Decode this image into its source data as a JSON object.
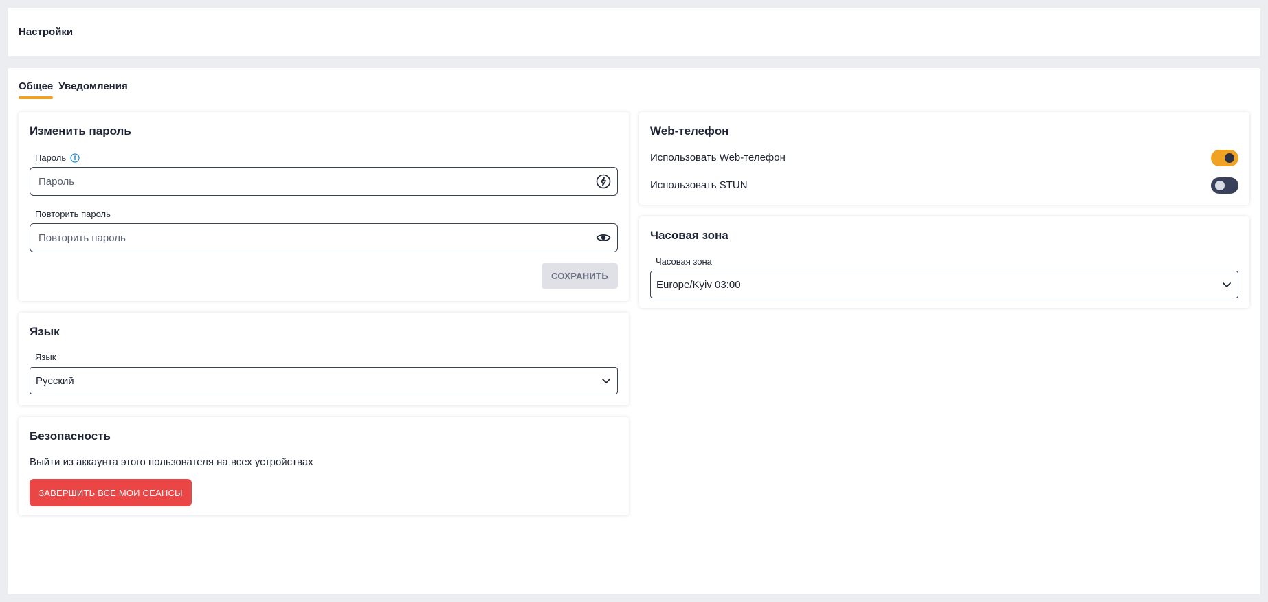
{
  "header": {
    "title": "Настройки"
  },
  "tabs": [
    {
      "label": "Общее",
      "active": true
    },
    {
      "label": "Уведомления",
      "active": false
    }
  ],
  "password_card": {
    "title": "Изменить пароль",
    "password": {
      "label": "Пароль",
      "placeholder": "Пароль",
      "value": ""
    },
    "repeat": {
      "label": "Повторить пароль",
      "placeholder": "Повторить пароль",
      "value": ""
    },
    "save_label": "СОХРАНИТЬ"
  },
  "language_card": {
    "title": "Язык",
    "label": "Язык",
    "selected": "Русский"
  },
  "security_card": {
    "title": "Безопасность",
    "description": "Выйти из аккаунта этого пользователя на всех устройствах",
    "button_label": "ЗАВЕРШИТЬ ВСЕ МОИ СЕАНСЫ"
  },
  "webphone_card": {
    "title": "Web-телефон",
    "options": [
      {
        "label": "Использовать Web-телефон",
        "enabled": true
      },
      {
        "label": "Использовать STUN",
        "enabled": false
      }
    ]
  },
  "timezone_card": {
    "title": "Часовая зона",
    "label": "Часовая зона",
    "selected": "Europe/Kyiv 03:00"
  },
  "colors": {
    "accent": "#f0a223",
    "danger": "#ea4646",
    "info": "#1f8fd6"
  }
}
